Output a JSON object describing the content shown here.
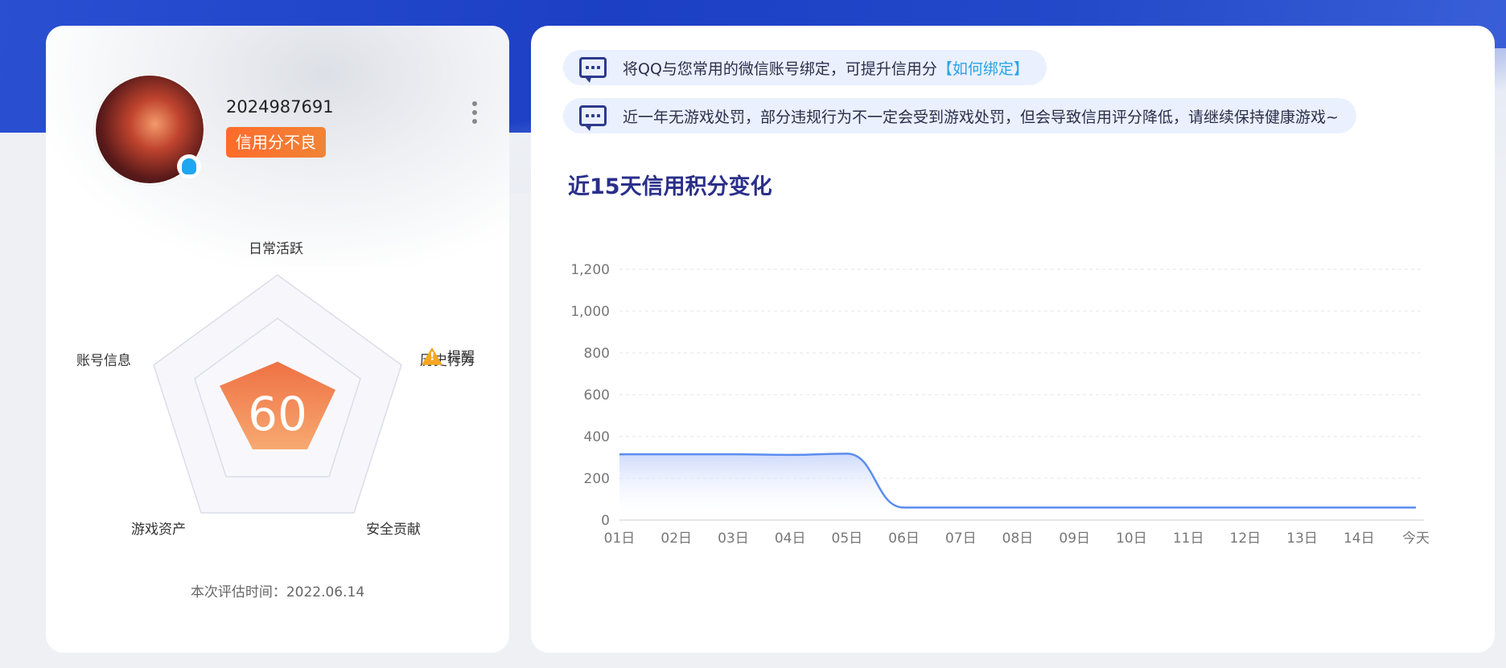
{
  "profile": {
    "user_id": "2024987691",
    "status": "信用分不良",
    "score": "60",
    "eval_time": "本次评估时间：2022.06.14",
    "avatar_icon": "avatar-image",
    "qq_icon": "qq-penguin-icon"
  },
  "radar": {
    "axes": [
      "日常活跃",
      "历史行为",
      "安全贡献",
      "游戏资产",
      "账号信息"
    ],
    "warning_label": "提醒",
    "score_color": "#f0813f"
  },
  "notices": [
    {
      "text": "将QQ与您常用的微信账号绑定，可提升信用分",
      "link": "【如何绑定】"
    },
    {
      "text": "近一年无游戏处罚，部分违规行为不一定会受到游戏处罚，但会导致信用评分降低，请继续保持健康游戏~"
    }
  ],
  "chart_title": "近15天信用积分变化",
  "chart_data": {
    "type": "area",
    "title": "近15天信用积分变化",
    "categories": [
      "01日",
      "02日",
      "03日",
      "04日",
      "05日",
      "06日",
      "07日",
      "08日",
      "09日",
      "10日",
      "11日",
      "12日",
      "13日",
      "14日",
      "今天"
    ],
    "values": [
      315,
      315,
      315,
      312,
      318,
      60,
      60,
      60,
      60,
      60,
      60,
      60,
      60,
      60,
      60
    ],
    "ylim": [
      0,
      1200
    ],
    "yticks": [
      0,
      200,
      400,
      600,
      800,
      1000,
      1200
    ],
    "ytick_labels": [
      "0",
      "200",
      "400",
      "600",
      "800",
      "1,000",
      "1,200"
    ],
    "grid": true,
    "line_color": "#5b8def",
    "fill_color": "#c9d6fb"
  }
}
